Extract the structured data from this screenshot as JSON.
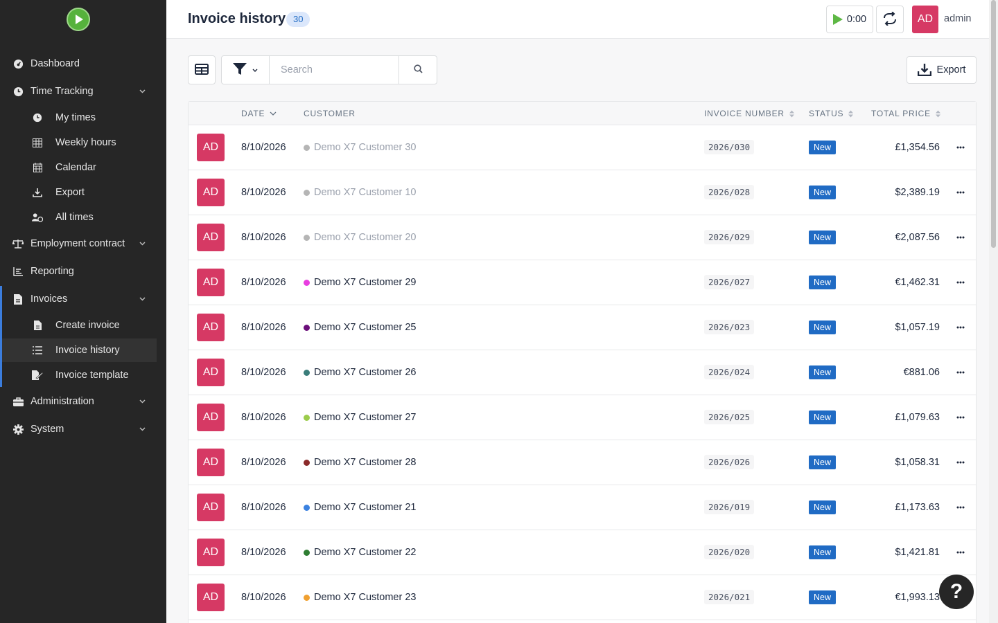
{
  "sidebar": {
    "items": [
      {
        "label": "Dashboard",
        "icon": "dashboard-icon"
      },
      {
        "label": "Time Tracking",
        "icon": "clock-icon"
      },
      {
        "label": "Employment contract",
        "icon": "scale-icon"
      },
      {
        "label": "Reporting",
        "icon": "chart-icon"
      },
      {
        "label": "Invoices",
        "icon": "file-invoice-icon"
      },
      {
        "label": "Administration",
        "icon": "toolbox-icon"
      },
      {
        "label": "System",
        "icon": "gear-icon"
      }
    ],
    "time_tracking_sub": [
      {
        "label": "My times",
        "icon": "clock-icon"
      },
      {
        "label": "Weekly hours",
        "icon": "table-icon"
      },
      {
        "label": "Calendar",
        "icon": "calendar-icon"
      },
      {
        "label": "Export",
        "icon": "download-icon"
      },
      {
        "label": "All times",
        "icon": "user-clock-icon"
      }
    ],
    "invoices_sub": [
      {
        "label": "Create invoice",
        "icon": "file-icon"
      },
      {
        "label": "Invoice history",
        "icon": "list-icon"
      },
      {
        "label": "Invoice template",
        "icon": "file-signature-icon"
      }
    ],
    "active_color": "#3b7ddd"
  },
  "header": {
    "title": "Invoice history",
    "count": "30",
    "timer": "0:00",
    "user_initials": "AD",
    "user_name": "admin"
  },
  "toolbar": {
    "search_placeholder": "Search",
    "export_label": "Export"
  },
  "table": {
    "columns": [
      "Date",
      "Customer",
      "Invoice number",
      "Status",
      "Total price"
    ],
    "rows": [
      {
        "avatar": "AD",
        "date": "8/10/2026",
        "customer": "Demo X7 Customer 30",
        "dot": "#b5b5b5",
        "muted": true,
        "invoice": "2026/030",
        "status": "New",
        "price": "£1,354.56"
      },
      {
        "avatar": "AD",
        "date": "8/10/2026",
        "customer": "Demo X7 Customer 10",
        "dot": "#b5b5b5",
        "muted": true,
        "invoice": "2026/028",
        "status": "New",
        "price": "$2,389.19"
      },
      {
        "avatar": "AD",
        "date": "8/10/2026",
        "customer": "Demo X7 Customer 20",
        "dot": "#b5b5b5",
        "muted": true,
        "invoice": "2026/029",
        "status": "New",
        "price": "€2,087.56"
      },
      {
        "avatar": "AD",
        "date": "8/10/2026",
        "customer": "Demo X7 Customer 29",
        "dot": "#e83ee0",
        "muted": false,
        "invoice": "2026/027",
        "status": "New",
        "price": "€1,462.31"
      },
      {
        "avatar": "AD",
        "date": "8/10/2026",
        "customer": "Demo X7 Customer 25",
        "dot": "#6b0f7a",
        "muted": false,
        "invoice": "2026/023",
        "status": "New",
        "price": "$1,057.19"
      },
      {
        "avatar": "AD",
        "date": "8/10/2026",
        "customer": "Demo X7 Customer 26",
        "dot": "#3a7d7a",
        "muted": false,
        "invoice": "2026/024",
        "status": "New",
        "price": "€881.06"
      },
      {
        "avatar": "AD",
        "date": "8/10/2026",
        "customer": "Demo X7 Customer 27",
        "dot": "#9ccc4c",
        "muted": false,
        "invoice": "2026/025",
        "status": "New",
        "price": "£1,079.63"
      },
      {
        "avatar": "AD",
        "date": "8/10/2026",
        "customer": "Demo X7 Customer 28",
        "dot": "#8b2a2a",
        "muted": false,
        "invoice": "2026/026",
        "status": "New",
        "price": "$1,058.31"
      },
      {
        "avatar": "AD",
        "date": "8/10/2026",
        "customer": "Demo X7 Customer 21",
        "dot": "#3b82e0",
        "muted": false,
        "invoice": "2026/019",
        "status": "New",
        "price": "£1,173.63"
      },
      {
        "avatar": "AD",
        "date": "8/10/2026",
        "customer": "Demo X7 Customer 22",
        "dot": "#2e7d32",
        "muted": false,
        "invoice": "2026/020",
        "status": "New",
        "price": "$1,421.81"
      },
      {
        "avatar": "AD",
        "date": "8/10/2026",
        "customer": "Demo X7 Customer 23",
        "dot": "#f0a030",
        "muted": false,
        "invoice": "2026/021",
        "status": "New",
        "price": "€1,993.13"
      }
    ]
  },
  "help": {
    "label": "?"
  }
}
